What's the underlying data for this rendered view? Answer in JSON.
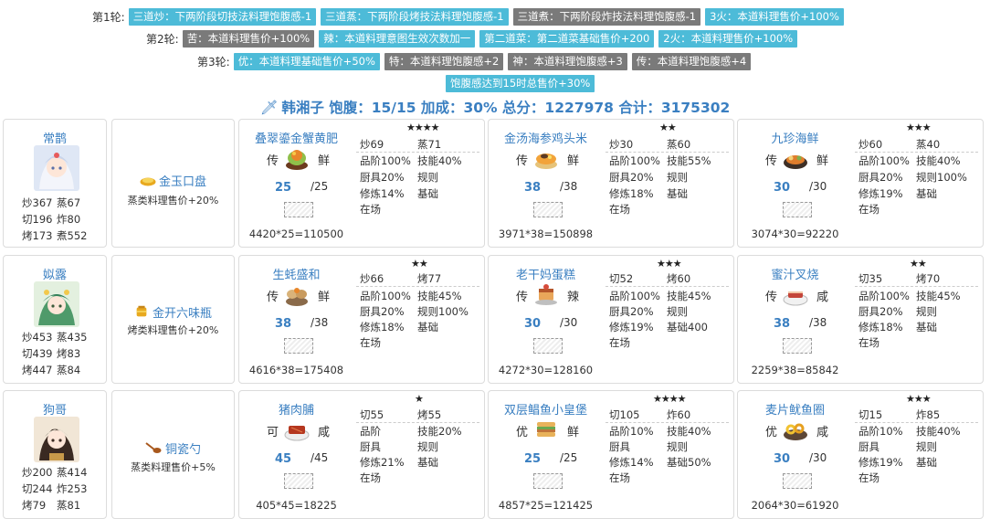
{
  "rules": {
    "round1": {
      "label": "第1轮:",
      "tags": [
        {
          "text": "三道炒：下两阶段切技法料理饱腹感-1",
          "color": "blue"
        },
        {
          "text": "三道蒸：下两阶段烤技法料理饱腹感-1",
          "color": "blue"
        },
        {
          "text": "三道煮：下两阶段炸技法料理饱腹感-1",
          "color": "gray"
        },
        {
          "text": "3火：本道料理售价+100%",
          "color": "blue"
        }
      ]
    },
    "round2": {
      "label": "第2轮:",
      "tags": [
        {
          "text": "苦：本道料理售价+100%",
          "color": "gray"
        },
        {
          "text": "辣：本道料理意图生效次数加一",
          "color": "blue"
        },
        {
          "text": "第二道菜：第二道菜基础售价+200",
          "color": "blue"
        },
        {
          "text": "2火：本道料理售价+100%",
          "color": "blue"
        }
      ]
    },
    "round3": {
      "label": "第3轮:",
      "tags": [
        {
          "text": "优：本道料理基础售价+50%",
          "color": "blue"
        },
        {
          "text": "特：本道料理饱腹感+2",
          "color": "gray"
        },
        {
          "text": "神：本道料理饱腹感+3",
          "color": "gray"
        },
        {
          "text": "传：本道料理饱腹感+4",
          "color": "gray"
        }
      ]
    },
    "extra": {
      "text": "饱腹感达到15时总售价+30%",
      "color": "blue"
    }
  },
  "summary": {
    "knife": "🗡",
    "text": "韩湘子 饱腹：15/15 加成：30% 总分：1227978 合计：3175302"
  },
  "rows": [
    {
      "chef": {
        "name": "常鹊",
        "stats": [
          "炒367",
          "蒸67",
          "切196",
          "炸80",
          "烤173",
          "煮552"
        ]
      },
      "equip": {
        "name": "金玉口盘",
        "desc": "蒸类料理售价+20%",
        "icon": "plate-icon"
      },
      "dishes": [
        {
          "name": "叠翠鎏金蟹黄肥",
          "stars": "★★★★",
          "tag_left": "传",
          "tag_right": "鲜",
          "qty": "25",
          "qmax": "/25",
          "calc": "4420*25=110500",
          "stats": [
            "炒69",
            "蒸71",
            "品阶100%",
            "技能40%",
            "厨具20%",
            "规则",
            "修炼14%",
            "基础",
            "在场",
            ""
          ]
        },
        {
          "name": "金汤海参鸡头米",
          "stars": "★★",
          "tag_left": "传",
          "tag_right": "鲜",
          "qty": "38",
          "qmax": "/38",
          "calc": "3971*38=150898",
          "stats": [
            "炒30",
            "蒸60",
            "品阶100%",
            "技能55%",
            "厨具20%",
            "规则",
            "修炼18%",
            "基础",
            "在场",
            ""
          ]
        },
        {
          "name": "九珍海鲜",
          "stars": "★★★",
          "tag_left": "传",
          "tag_right": "鲜",
          "qty": "30",
          "qmax": "/30",
          "calc": "3074*30=92220",
          "stats": [
            "炒60",
            "蒸40",
            "品阶100%",
            "技能40%",
            "厨具20%",
            "规则100%",
            "修炼19%",
            "基础",
            "在场",
            ""
          ]
        }
      ]
    },
    {
      "chef": {
        "name": "姒露",
        "stats": [
          "炒453",
          "蒸435",
          "切439",
          "烤83",
          "烤447",
          "蒸84"
        ]
      },
      "equip": {
        "name": "金开六味瓶",
        "desc": "烤类料理售价+20%",
        "icon": "jar-icon"
      },
      "dishes": [
        {
          "name": "生蚝盛和",
          "stars": "★★",
          "tag_left": "传",
          "tag_right": "鲜",
          "qty": "38",
          "qmax": "/38",
          "calc": "4616*38=175408",
          "stats": [
            "炒66",
            "烤77",
            "品阶100%",
            "技能45%",
            "厨具20%",
            "规则100%",
            "修炼18%",
            "基础",
            "在场",
            ""
          ]
        },
        {
          "name": "老干妈蛋糕",
          "stars": "★★★",
          "tag_left": "传",
          "tag_right": "辣",
          "qty": "30",
          "qmax": "/30",
          "calc": "4272*30=128160",
          "stats": [
            "切52",
            "烤60",
            "品阶100%",
            "技能45%",
            "厨具20%",
            "规则",
            "修炼19%",
            "基础400",
            "在场",
            ""
          ]
        },
        {
          "name": "蜜汁叉烧",
          "stars": "★★",
          "tag_left": "传",
          "tag_right": "咸",
          "qty": "38",
          "qmax": "/38",
          "calc": "2259*38=85842",
          "stats": [
            "切35",
            "烤70",
            "品阶100%",
            "技能45%",
            "厨具20%",
            "规则",
            "修炼18%",
            "基础",
            "在场",
            ""
          ]
        }
      ]
    },
    {
      "chef": {
        "name": "狗哥",
        "stats": [
          "炒200",
          "蒸414",
          "切244",
          "炸253",
          "烤79",
          "蒸81"
        ]
      },
      "equip": {
        "name": "铜瓷勺",
        "desc": "蒸类料理售价+5%",
        "icon": "spoon-icon"
      },
      "dishes": [
        {
          "name": "猪肉脯",
          "stars": "★",
          "tag_left": "可",
          "tag_right": "咸",
          "qty": "45",
          "qmax": "/45",
          "calc": "405*45=18225",
          "stats": [
            "切55",
            "烤55",
            "品阶",
            "技能20%",
            "厨具",
            "规则",
            "修炼21%",
            "基础",
            "在场",
            ""
          ]
        },
        {
          "name": "双层鲳鱼小皇堡",
          "stars": "★★★★",
          "tag_left": "优",
          "tag_right": "鲜",
          "qty": "25",
          "qmax": "/25",
          "calc": "4857*25=121425",
          "stats": [
            "切105",
            "炸60",
            "品阶10%",
            "技能40%",
            "厨具",
            "规则",
            "修炼14%",
            "基础50%",
            "在场",
            ""
          ]
        },
        {
          "name": "麦片鱿鱼圈",
          "stars": "★★★",
          "tag_left": "优",
          "tag_right": "咸",
          "qty": "30",
          "qmax": "/30",
          "calc": "2064*30=61920",
          "stats": [
            "切15",
            "炸85",
            "品阶10%",
            "技能40%",
            "厨具",
            "规则",
            "修炼19%",
            "基础",
            "在场",
            ""
          ]
        }
      ]
    }
  ]
}
